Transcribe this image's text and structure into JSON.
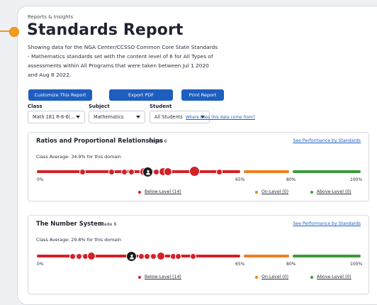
{
  "breadcrumb": "Reports & Insights",
  "title": "Standards Report",
  "description": "Showing data for the NGA Center/CCSSO Common Core State Standards - Mathematics standards set with the content level of 6 for All Types of assessments within All Programs that were taken between Jul 1 2020 and Aug 8 2022.",
  "actions": {
    "customize": "Customize This Report",
    "export": "Export PDF",
    "print": "Print Report"
  },
  "filters": {
    "class_label": "Class",
    "class_value": "Math 181 R-6-6(...",
    "subject_label": "Subject",
    "subject_value": "Mathematics",
    "student_label": "Student",
    "student_value": "All Students"
  },
  "data_source_link": "Where does this data come from?",
  "colors": {
    "accent": "#1e5ebf",
    "below": "#d12228",
    "on": "#ee7f22",
    "above": "#3e9a3a",
    "connector": "#f29a1e"
  },
  "domains": [
    {
      "title": "Ratios and Proportional Relationships",
      "grade": "Grade 6",
      "perf_link": "See Performance by Standards",
      "average": "Class Average: 34.9% for this domain",
      "ticks": [
        "0%",
        "65%",
        "80%",
        "100%"
      ],
      "legend": {
        "below": "Below-Level (14)",
        "on": "On-Level (0)",
        "above": "Above-Level (0)"
      }
    },
    {
      "title": "The Number System",
      "grade": "Grade 6",
      "perf_link": "See Performance by Standards",
      "average": "Class Average: 29.8% for this domain",
      "ticks": [
        "0%",
        "65%",
        "80%",
        "100%"
      ],
      "legend": {
        "below": "Below-Level (14)",
        "on": "On-Level (0)",
        "above": "Above-Level (0)"
      }
    }
  ]
}
